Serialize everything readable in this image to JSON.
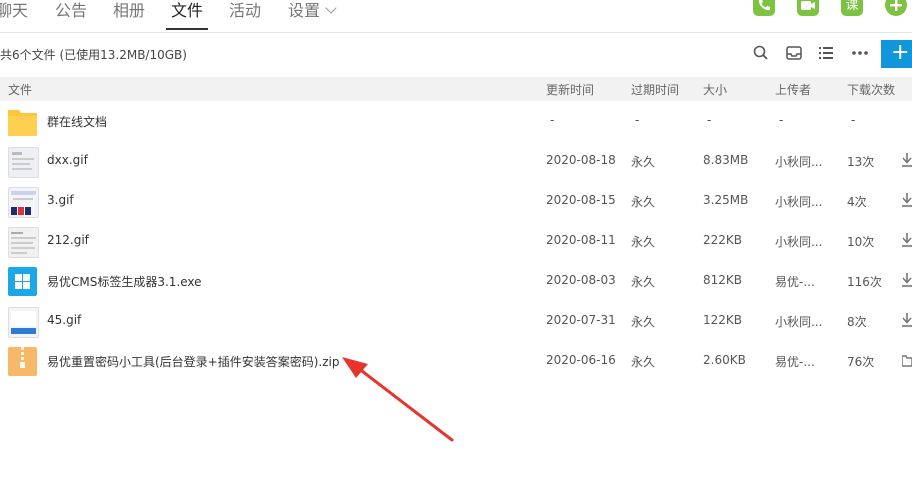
{
  "nav": {
    "tabs": [
      {
        "label": "聊天"
      },
      {
        "label": "公告"
      },
      {
        "label": "相册"
      },
      {
        "label": "文件"
      },
      {
        "label": "活动"
      },
      {
        "label": "设置"
      }
    ],
    "active_tab": "文件",
    "course_icon_label": "课"
  },
  "summary": "共6个文件 (已使用13.2MB/10GB)",
  "toolbar": {
    "add_label": "+"
  },
  "columns": {
    "name": "文件",
    "updated": "更新时间",
    "expires": "过期时间",
    "size": "大小",
    "uploader": "上传者",
    "downloads": "下载次数"
  },
  "rows": [
    {
      "name": "群在线文档",
      "updated": "-",
      "expires": "-",
      "size": "-",
      "uploader": "-",
      "downloads": "-",
      "icon": "folder-icon"
    },
    {
      "name": "dxx.gif",
      "updated": "2020-08-18",
      "expires": "永久",
      "size": "8.83MB",
      "uploader": "小秋同...",
      "downloads": "13次",
      "icon": "image-thumbnail"
    },
    {
      "name": "3.gif",
      "updated": "2020-08-15",
      "expires": "永久",
      "size": "3.25MB",
      "uploader": "小秋同...",
      "downloads": "4次",
      "icon": "image-thumbnail"
    },
    {
      "name": "212.gif",
      "updated": "2020-08-11",
      "expires": "永久",
      "size": "222KB",
      "uploader": "小秋同...",
      "downloads": "10次",
      "icon": "image-thumbnail"
    },
    {
      "name": "易优CMS标签生成器3.1.exe",
      "updated": "2020-08-03",
      "expires": "永久",
      "size": "812KB",
      "uploader": "易优-...",
      "downloads": "116次",
      "icon": "exe-icon"
    },
    {
      "name": "45.gif",
      "updated": "2020-07-31",
      "expires": "永久",
      "size": "122KB",
      "uploader": "小秋同...",
      "downloads": "8次",
      "icon": "image-thumbnail"
    },
    {
      "name": "易优重置密码小工具(后台登录+插件安装答案密码).zip",
      "updated": "2020-06-16",
      "expires": "永久",
      "size": "2.60KB",
      "uploader": "易优-...",
      "downloads": "76次",
      "icon": "zip-icon"
    }
  ],
  "colors": {
    "accent_blue": "#1296db",
    "green_icon": "#7ec242",
    "folder_yellow": "#ffc53d",
    "zip_orange": "#f7b86a",
    "annotation_red": "#e8332e"
  }
}
